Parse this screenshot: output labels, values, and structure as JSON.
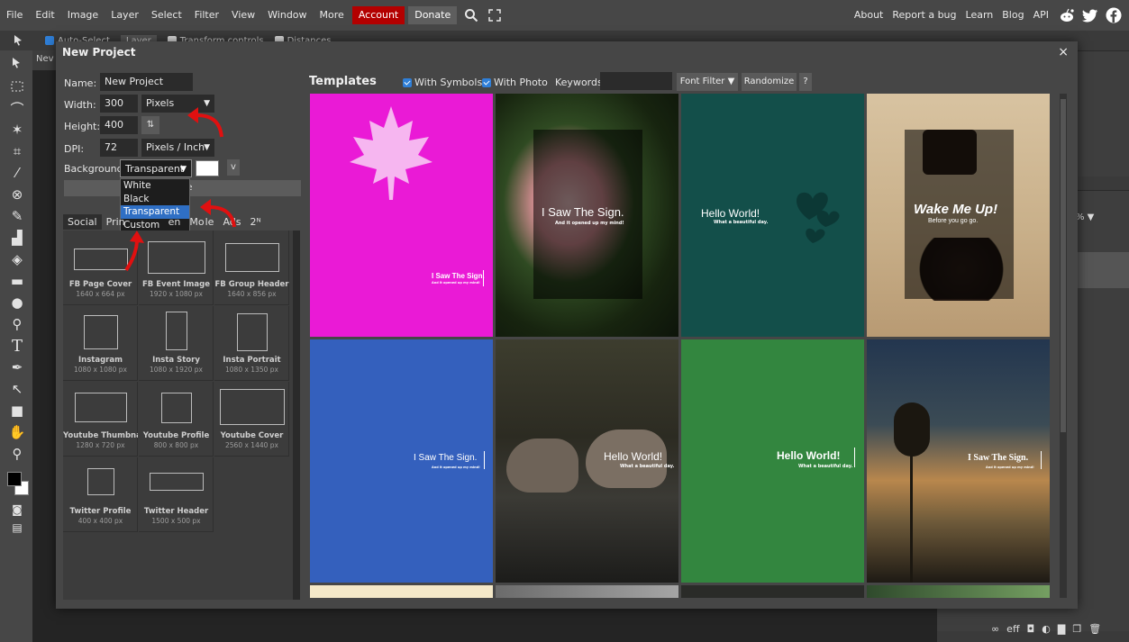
{
  "menu": {
    "items": [
      "File",
      "Edit",
      "Image",
      "Layer",
      "Select",
      "Filter",
      "View",
      "Window",
      "More"
    ],
    "account": "Account",
    "donate": "Donate",
    "right": [
      "About",
      "Report a bug",
      "Learn",
      "Blog",
      "API"
    ]
  },
  "options_bar": {
    "auto_select": "Auto-Select",
    "layer": "Layer",
    "transform": "Transform controls",
    "distances": "Distances"
  },
  "doc_tab": "Nev",
  "dialog": {
    "title": "New Project",
    "close": "×",
    "name_label": "Name:",
    "name_value": "New Project",
    "width_label": "Width:",
    "width_value": "300",
    "width_unit": "Pixels",
    "height_label": "Height:",
    "height_value": "400",
    "swap_label": "⇅",
    "dpi_label": "DPI:",
    "dpi_value": "72",
    "dpi_unit": "Pixels / Inch",
    "bg_label": "Background:",
    "bg_value": "Transparent",
    "bg_options": [
      "White",
      "Black",
      "Transparent",
      "Custom"
    ],
    "bg_more": "v",
    "create_label": "e",
    "preset_tabs": [
      "Social",
      "Prin",
      "en",
      "Mo",
      "le",
      "Ads",
      "2ᴺ"
    ],
    "presets": [
      {
        "name": "FB Page Cover",
        "size": "1640 x 664 px"
      },
      {
        "name": "FB Event Image",
        "size": "1920 x 1080 px"
      },
      {
        "name": "FB Group Header",
        "size": "1640 x 856 px"
      },
      {
        "name": "Instagram",
        "size": "1080 x 1080 px"
      },
      {
        "name": "Insta Story",
        "size": "1080 x 1920 px"
      },
      {
        "name": "Insta Portrait",
        "size": "1080 x 1350 px"
      },
      {
        "name": "Youtube Thumbnail",
        "size": "1280 x 720 px"
      },
      {
        "name": "Youtube Profile",
        "size": "800 x 800 px"
      },
      {
        "name": "Youtube Cover",
        "size": "2560 x 1440 px"
      },
      {
        "name": "Twitter Profile",
        "size": "400 x 400 px"
      },
      {
        "name": "Twitter Header",
        "size": "1500 x 500 px"
      }
    ],
    "templates_title": "Templates",
    "with_symbols": "With Symbols",
    "with_photo": "With Photo",
    "keywords_label": "Keywords:",
    "keywords_value": "",
    "font_filter": "Font Filter ▼",
    "randomize": "Randomize",
    "help": "?"
  },
  "templates": [
    {
      "main": "I Saw The Sign.",
      "sub": "And it opened up my mind!"
    },
    {
      "main": "I Saw The Sign.",
      "sub": "And it opened up my mind!"
    },
    {
      "main": "Hello World!",
      "sub": "What a beautiful day."
    },
    {
      "main": "Wake Me Up!",
      "sub": "Before you go go."
    },
    {
      "main": "I Saw The Sign.",
      "sub": "And it opened up my mind!"
    },
    {
      "main": "Hello World!",
      "sub": "What a beautiful day."
    },
    {
      "main": "Hello World!",
      "sub": "What a beautiful day."
    },
    {
      "main": "I Saw The Sign.",
      "sub": "And it opened up my mind!"
    }
  ],
  "right_panel_zoom": "% ▼",
  "colors": {
    "accent": "#2f7fd8",
    "account_red": "#b30000",
    "magenta": "#ea1ad6",
    "teal": "#134f4a",
    "blue": "#3460bd",
    "green": "#33863f"
  }
}
